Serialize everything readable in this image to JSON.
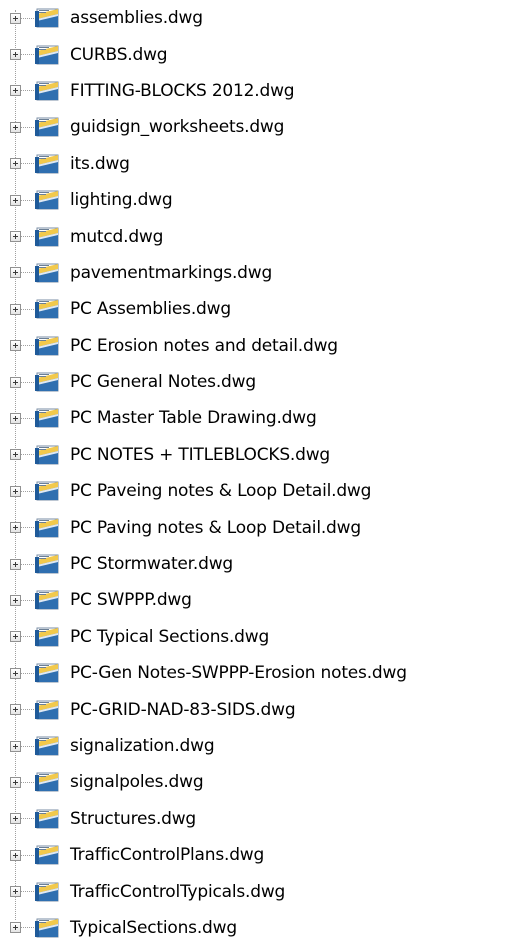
{
  "tree": {
    "expander_symbol": "plus",
    "item_icon": "dwg-file-icon",
    "items": [
      {
        "label": "assemblies.dwg"
      },
      {
        "label": "CURBS.dwg"
      },
      {
        "label": "FITTING-BLOCKS 2012.dwg"
      },
      {
        "label": "guidsign_worksheets.dwg"
      },
      {
        "label": "its.dwg"
      },
      {
        "label": "lighting.dwg"
      },
      {
        "label": "mutcd.dwg"
      },
      {
        "label": "pavementmarkings.dwg"
      },
      {
        "label": "PC Assemblies.dwg"
      },
      {
        "label": "PC Erosion notes and detail.dwg"
      },
      {
        "label": "PC General Notes.dwg"
      },
      {
        "label": "PC Master Table Drawing.dwg"
      },
      {
        "label": "PC NOTES + TITLEBLOCKS.dwg"
      },
      {
        "label": "PC Paveing notes & Loop Detail.dwg"
      },
      {
        "label": "PC Paving notes & Loop Detail.dwg"
      },
      {
        "label": "PC Stormwater.dwg"
      },
      {
        "label": "PC SWPPP.dwg"
      },
      {
        "label": "PC Typical Sections.dwg"
      },
      {
        "label": "PC-Gen Notes-SWPPP-Erosion notes.dwg"
      },
      {
        "label": "PC-GRID-NAD-83-SIDS.dwg"
      },
      {
        "label": "signalization.dwg"
      },
      {
        "label": "signalpoles.dwg"
      },
      {
        "label": "Structures.dwg"
      },
      {
        "label": "TrafficControlPlans.dwg"
      },
      {
        "label": "TrafficControlTypicals.dwg"
      },
      {
        "label": "TypicalSections.dwg"
      }
    ]
  },
  "colors": {
    "icon_body": "#2f6fb0",
    "icon_fold": "#f2c94c",
    "guide_line": "#a0a0a0",
    "expander_border": "#919191"
  }
}
